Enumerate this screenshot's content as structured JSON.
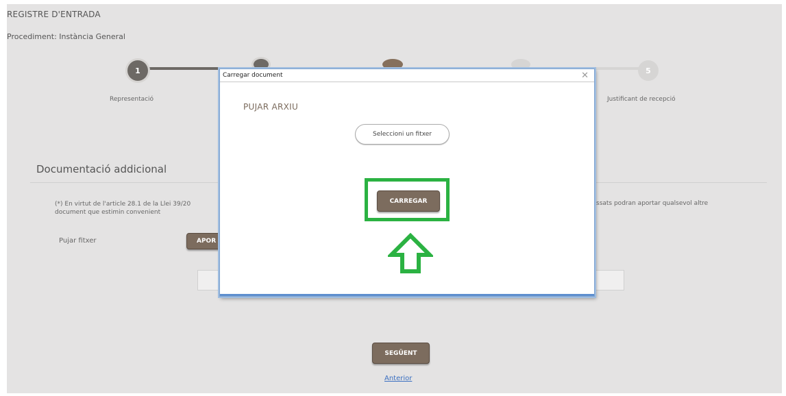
{
  "header": {
    "title": "REGISTRE D'ENTRADA",
    "procedure": "Procediment: Instància General"
  },
  "steps": [
    {
      "number": "1",
      "label": "Representació"
    },
    {
      "number": "",
      "label": ""
    },
    {
      "number": "",
      "label": ""
    },
    {
      "number": "",
      "label": ""
    },
    {
      "number": "5",
      "label": "Justificant de recepció"
    }
  ],
  "section": {
    "title": "Documentació addicional",
    "note_left": "(*) En virtut de l'article 28.1 de la Llei 39/20",
    "note_left_2": "document que estimin convenient",
    "note_right": "ssats podran aportar qualsevol altre",
    "upload_label": "Pujar fitxer",
    "aportar_label": "APOR"
  },
  "footer": {
    "next_label": "SEGÜENT",
    "previous_label": "Anterior"
  },
  "modal": {
    "title": "Carregar document",
    "close_glyph": "✕",
    "heading": "PUJAR ARXIU",
    "select_file_label": "Seleccioni un fitxer",
    "upload_button_label": "CARREGAR"
  },
  "annotation": {
    "highlight_color": "#2bb242",
    "arrow_icon": "up-arrow-icon"
  },
  "colors": {
    "brown_button": "#7c6c5e",
    "modal_border": "#5e8fcf",
    "page_bg": "#e4e3e3"
  }
}
